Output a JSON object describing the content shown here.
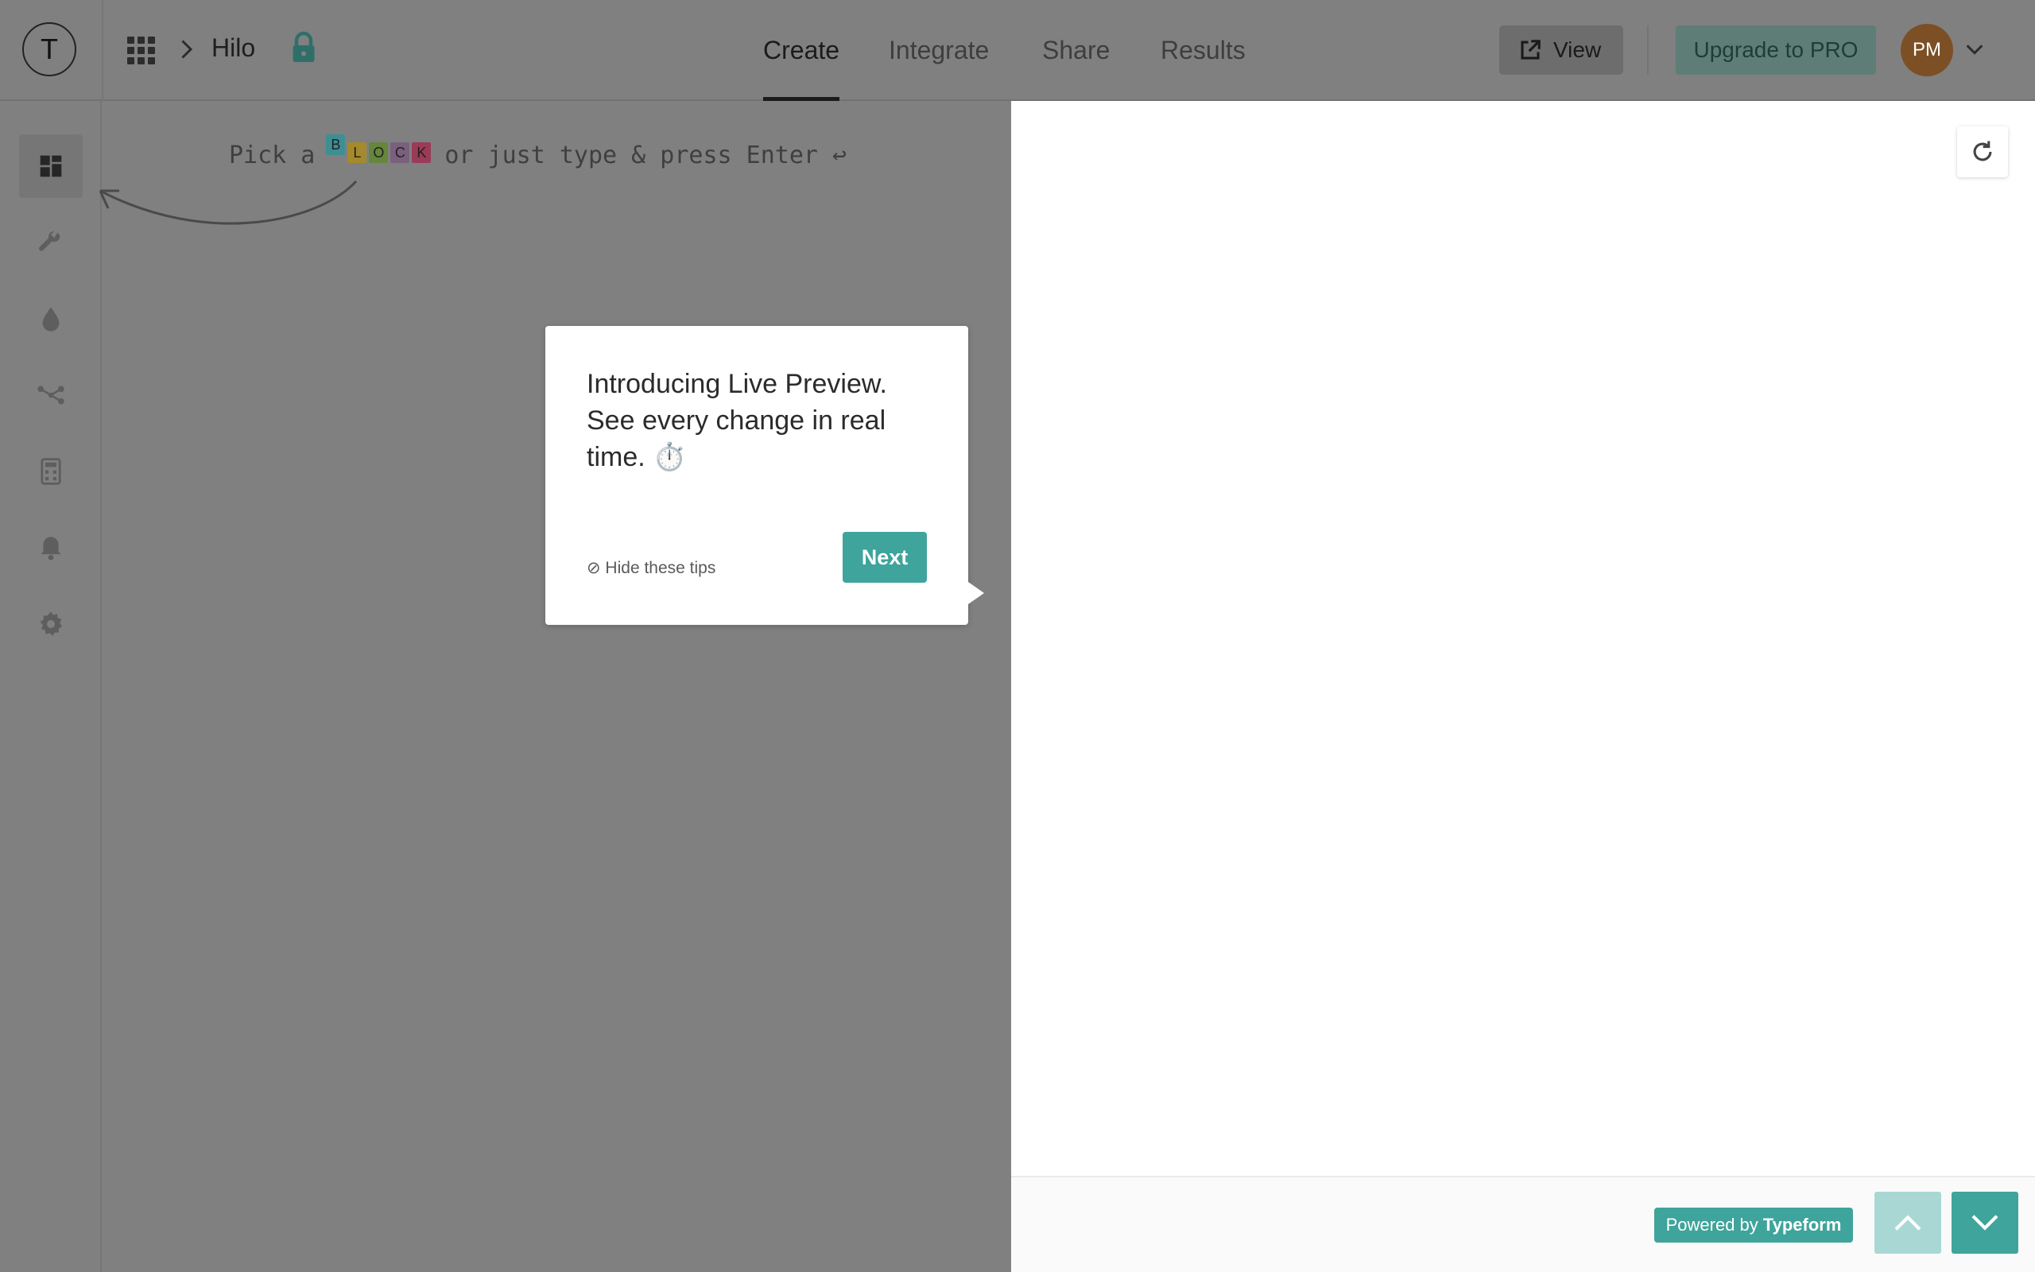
{
  "app": {
    "logo_letter": "T",
    "workspace": "Hilo"
  },
  "tabs": [
    {
      "label": "Create",
      "active": true
    },
    {
      "label": "Integrate",
      "active": false
    },
    {
      "label": "Share",
      "active": false
    },
    {
      "label": "Results",
      "active": false
    }
  ],
  "header": {
    "view_label": "View",
    "upgrade_label": "Upgrade to PRO",
    "avatar_initials": "PM"
  },
  "sidebar": {
    "items": [
      {
        "icon": "blocks-icon",
        "active": true
      },
      {
        "icon": "wrench-icon",
        "active": false
      },
      {
        "icon": "drop-icon",
        "active": false
      },
      {
        "icon": "logic-icon",
        "active": false
      },
      {
        "icon": "calculator-icon",
        "active": false
      },
      {
        "icon": "bell-icon",
        "active": false
      },
      {
        "icon": "gear-icon",
        "active": false
      }
    ]
  },
  "editor": {
    "hint_before": "Pick a",
    "hint_after": "or just type & press Enter ↩",
    "block_letters": [
      {
        "letter": "B",
        "color": "#3e8f93"
      },
      {
        "letter": "L",
        "color": "#a58a2b"
      },
      {
        "letter": "O",
        "color": "#66863b"
      },
      {
        "letter": "C",
        "color": "#7b607e"
      },
      {
        "letter": "K",
        "color": "#9a3b58"
      }
    ]
  },
  "tooltip": {
    "title": "Introducing Live Preview. See every change in real time. ⏱️",
    "hide_label": "⊘ Hide these tips",
    "next_label": "Next"
  },
  "preview": {
    "powered_prefix": "Powered by",
    "powered_brand": "Typeform"
  },
  "colors": {
    "accent": "#3fa49b",
    "accent_light": "#a9d8d4",
    "overlay": "#808080"
  }
}
